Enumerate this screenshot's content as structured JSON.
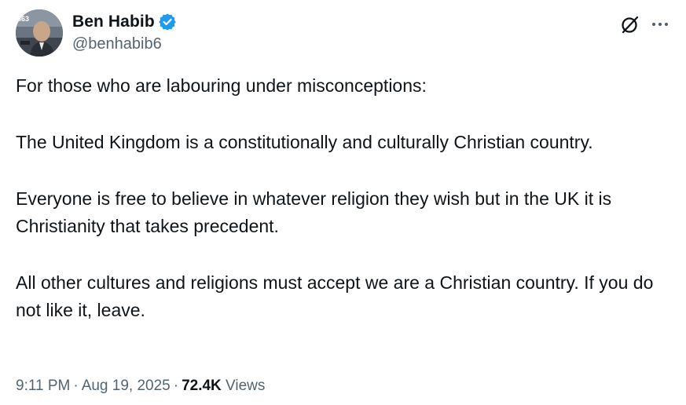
{
  "author": {
    "display_name": "Ben Habib",
    "handle": "@benhabib6",
    "verified": true,
    "verified_color": "#1d9bf0",
    "avatar_badge_text": "863"
  },
  "header_actions": {
    "grok_icon": "grok-icon",
    "more_icon": "more-icon"
  },
  "tweet": {
    "paragraphs": [
      "For those who are labouring under misconceptions:",
      "The United Kingdom is a constitutionally and culturally Christian country.",
      "Everyone is free to believe in whatever religion they wish but in the UK it is Christianity that takes precedent.",
      "All other cultures and religions must accept we are a Christian country. If you do not like it, leave."
    ]
  },
  "meta": {
    "time": "9:11 PM",
    "separator": "·",
    "date": "Aug 19, 2025",
    "views_count": "72.4K",
    "views_label": "Views"
  },
  "colors": {
    "text_primary": "#0f1419",
    "text_secondary": "#536471",
    "background": "#ffffff"
  }
}
